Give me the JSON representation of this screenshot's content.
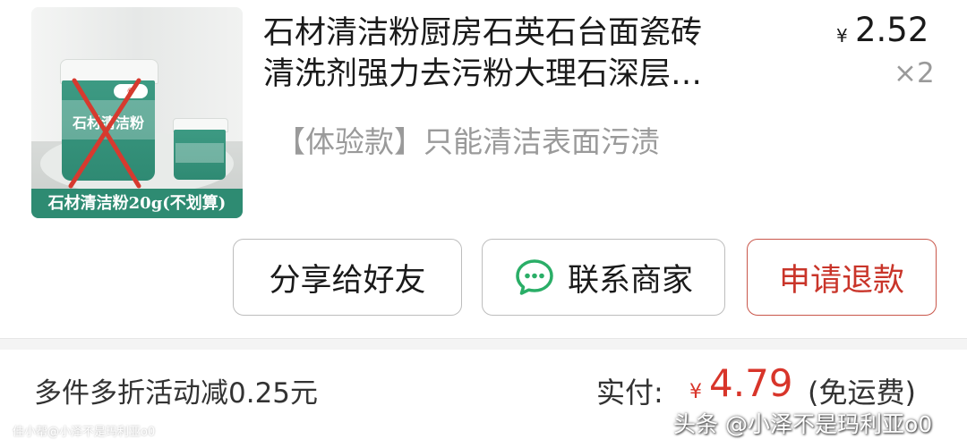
{
  "product": {
    "title_line1": "石材清洁粉厨房石英石台面瓷砖",
    "title_line2": "清洗剂强力去污粉大理石深层…",
    "currency": "¥",
    "price": "2.52",
    "quantity": "×2",
    "variant": "【体验款】只能清洁表面污渍",
    "image_banner": "石材清洁粉20g(不划算)",
    "image_jar_label": "石材清洁粉"
  },
  "actions": {
    "share_label": "分享给好友",
    "contact_label": "联系商家",
    "refund_label": "申请退款"
  },
  "summary": {
    "discount": "多件多折活动减0.25元",
    "paid_label": "实付:",
    "paid_currency": "¥",
    "paid_amount": "4.79",
    "shipping": "(免运费)"
  },
  "watermarks": {
    "left": "佳小帮@小泽不是玛利亚o0",
    "right": "头条 @小泽不是玛利亚o0"
  },
  "colors": {
    "price_red": "#d8352a",
    "refund_red": "#c9352a",
    "wechat_green": "#2aae67",
    "product_green": "#2e8b72"
  },
  "icons": {
    "chat": "chat-bubble-icon"
  }
}
